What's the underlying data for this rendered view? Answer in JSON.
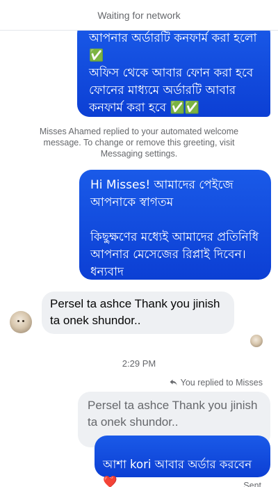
{
  "status": {
    "text": "Waiting for network"
  },
  "messages": {
    "m1": "আপনার অর্ডারটি কনফার্ম করা হলো ✅\nঅফিস থেকে আবার ফোন করা হবে ফোনের মাধ্যমে অর্ডারটি আবার কনফার্ম করা হবে ✅✅",
    "system_note": "Misses Ahamed replied to your automated welcome message. To change or remove this greeting, visit Messaging settings.",
    "m2": "Hi Misses! আমাদের পেইজে আপনাকে স্বাগতম\n\nকিছুক্ষণের মধ্যেই আমাদের প্রতিনিধি আপনার মেসেজের রিপ্লাই দিবেন। ধন্যবাদ",
    "m3": "Persel ta ashce Thank you jinish ta onek shundor..",
    "time": "2:29 PM",
    "reply_label": "You replied to Misses",
    "quoted": "Persel ta ashce Thank you jinish ta onek shundor..",
    "m4": "আশা kori আবার অর্ডার করবেন",
    "m4_emoji": "❤️",
    "status_sent": "Sent"
  },
  "colors": {
    "outgoing": "#0c3fd4",
    "incoming": "#eef0f3",
    "muted_text": "#65676b"
  },
  "icons": {
    "reply": "reply-arrow-icon",
    "avatar": "profile-avatar"
  }
}
